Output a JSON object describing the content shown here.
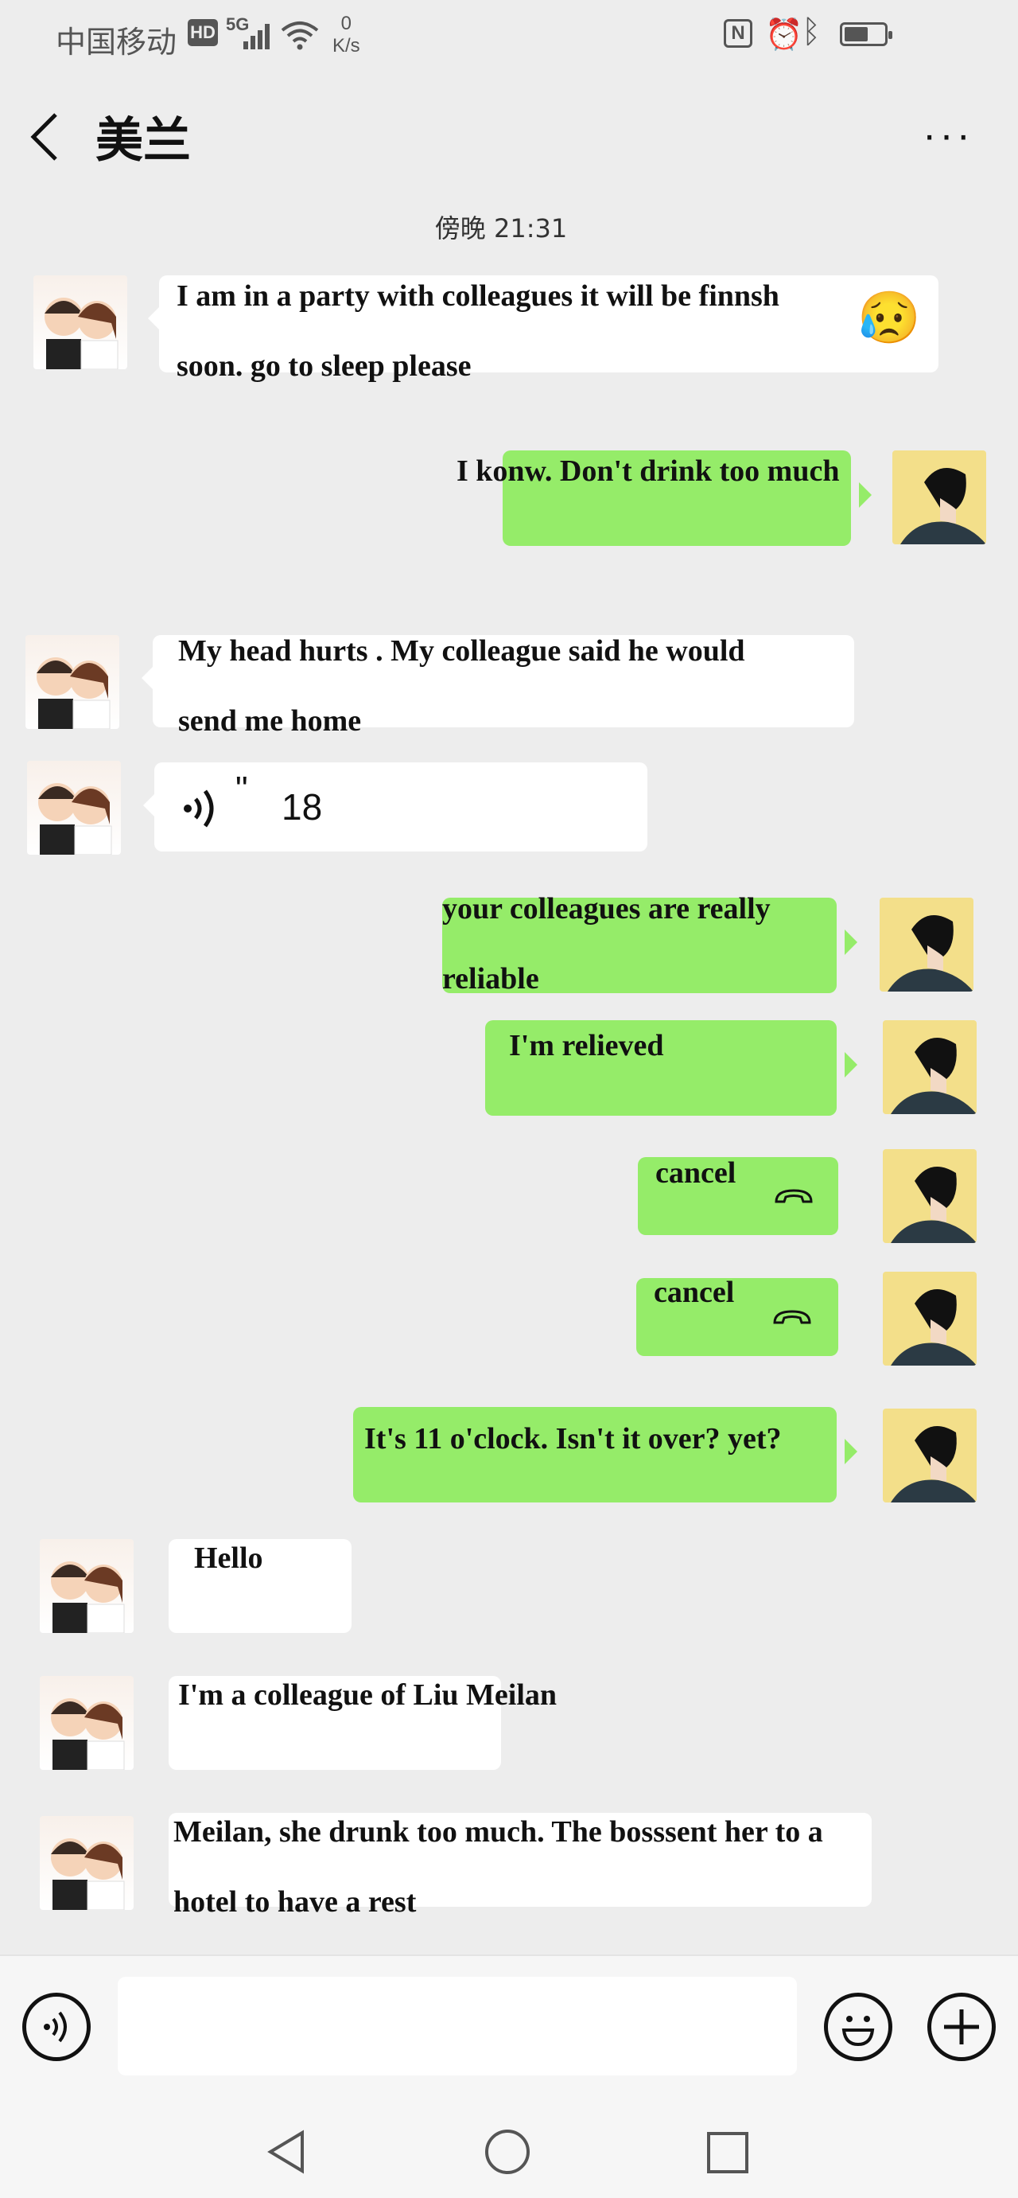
{
  "status_bar": {
    "carrier": "中国移动",
    "hd_badge": "HD",
    "network": "5G",
    "speed_value": "0",
    "speed_unit": "K/s",
    "nfc": "N",
    "battery_level": 0.6,
    "icons": [
      "signal-bars-icon",
      "wifi-icon",
      "nfc-icon",
      "alarm-icon",
      "bluetooth-icon",
      "battery-icon"
    ]
  },
  "header": {
    "title": "美兰",
    "more_label": "···"
  },
  "timestamp": "傍晚 21:31",
  "messages": {
    "m1": {
      "line1": "I am in a party with colleagues it will be finnsh",
      "line2": "soon. go to sleep please",
      "emoji": "😥"
    },
    "m2": {
      "text": "I konw. Don't drink too much"
    },
    "m3": {
      "line1": " My head hurts . My colleague said he would",
      "line2": "send me home"
    },
    "m4": {
      "duration": "18",
      "quote": "\""
    },
    "m5": {
      "line1": "your colleagues are really",
      "line2": "reliable"
    },
    "m6": {
      "text": "I'm relieved"
    },
    "m7": {
      "text": "cancel"
    },
    "m8": {
      "text": "cancel"
    },
    "m9": {
      "text": "It's 11 o'clock. Isn't it over? yet?"
    },
    "m10": {
      "text": "Hello"
    },
    "m11": {
      "text": "I'm a colleague of Liu Meilan"
    },
    "m12": {
      "line1": "Meilan, she  drunk too much. The bosssent her to a",
      "line2": "hotel to have a rest"
    }
  },
  "colors": {
    "sent_bubble": "#95ec69",
    "received_bubble": "#ffffff",
    "background": "#ededed"
  },
  "input_bar": {
    "icons": [
      "voice-icon",
      "emoji-icon",
      "plus-icon"
    ]
  },
  "nav_bar": {
    "icons": [
      "back-triangle-icon",
      "home-circle-icon",
      "recents-square-icon"
    ]
  }
}
